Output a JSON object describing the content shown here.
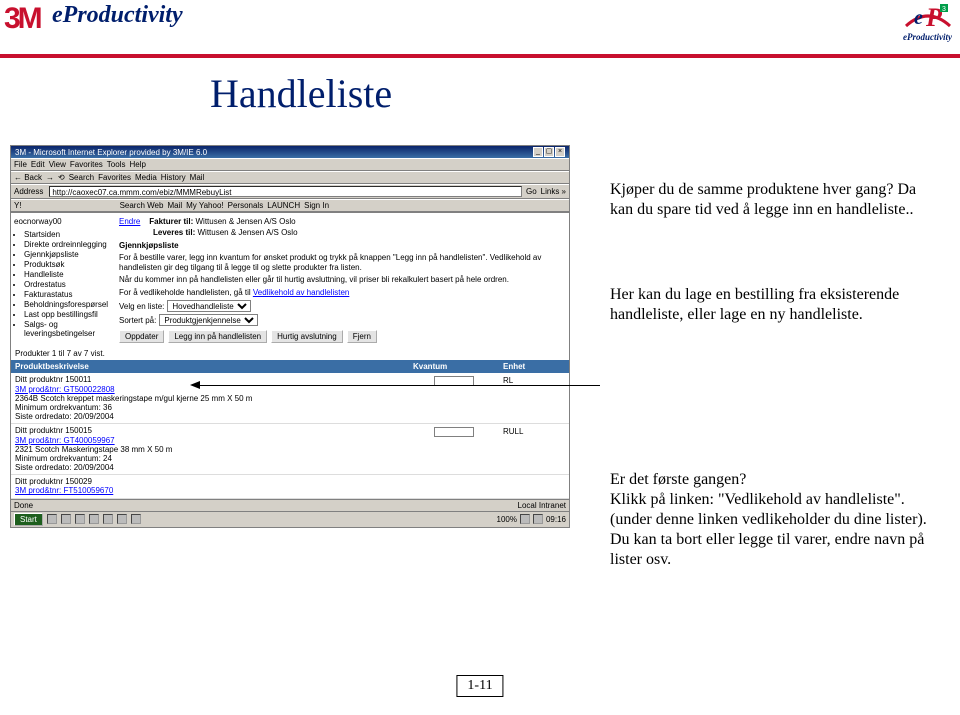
{
  "header": {
    "logo3m": "3M",
    "logoText": "eProductivity",
    "epSub": "eProductivity"
  },
  "slide": {
    "title": "Handleliste",
    "pageNumber": "1-11"
  },
  "browser": {
    "title": "3M - Microsoft Internet Explorer provided by 3M/IE 6.0",
    "menubar": [
      "File",
      "Edit",
      "View",
      "Favorites",
      "Tools",
      "Help"
    ],
    "toolbar": [
      "← Back",
      "→",
      "⟲",
      "Search",
      "Favorites",
      "Media",
      "History",
      "Mail"
    ],
    "addrLabel": "Address",
    "url": "http://caoxec07.ca.mmm.com/ebiz/MMMRebuyList",
    "goLabel": "Go",
    "linksLabel": "Links »",
    "ybar": [
      "Y!",
      "Search Web",
      "Mail",
      "My Yahoo!",
      "Personals",
      "LAUNCH",
      "Sign In"
    ],
    "account": "eocnorway00",
    "sideItems": [
      "Startsiden",
      "Direkte ordreinnlegging",
      "Gjennkjøpsliste",
      "Produktsøk",
      "Handleliste",
      "Ordrestatus",
      "Fakturastatus",
      "Beholdningsforespørsel",
      "Last opp bestillingsfil",
      "Salgs- og leveringsbetingelser"
    ],
    "endreLabel": "Endre",
    "faktLabel": "Fakturer til:",
    "faktVal": "Wittusen & Jensen A/S Oslo",
    "levLabel": "Leveres til:",
    "levVal": "Wittusen & Jensen A/S Oslo",
    "listTitle": "Gjennkjøpsliste",
    "para1": "For å bestille varer, legg inn kvantum for ønsket produkt og trykk på knappen \"Legg inn på handlelisten\". Vedlikehold av handlelisten gir deg tilgang til å legge til og slette produkter fra listen.",
    "para2": "Når du kommer inn på handlelisten eller går til hurtig avsluttning, vil priser bli rekalkulert basert på hele ordren.",
    "para3a": "For å vedlikeholde handlelisten, gå til ",
    "para3link": "Vedlikehold av handlelisten",
    "velgLabel": "Velg en liste:",
    "velgVal": "Hovedhandleliste",
    "sortLabel": "Sortert på:",
    "sortVal": "Produktgjenkjennelse",
    "buttons": [
      "Oppdater",
      "Legg inn på handlelisten",
      "Hurtig avslutning",
      "Fjern"
    ],
    "prodCount": "Produkter 1 til 7 av 7 vist.",
    "th1": "Produktbeskrivelse",
    "th2": "Kvantum",
    "th3": "Enhet",
    "prods": [
      {
        "pn": "Ditt produktnr 150011",
        "link": "3M prod&tnr: GT500022808",
        "desc": "2364B Scotch kreppet maskeringstape m/gul kjerne 25 mm X 50 m",
        "min": "Minimum ordrekvantum: 36",
        "date": "Siste ordredato: 20/09/2004",
        "unit": "RL"
      },
      {
        "pn": "Ditt produktnr 150015",
        "link": "3M prod&tnr: GT400059967",
        "desc": "2321 Scotch Maskeringstape 38 mm X 50 m",
        "min": "Minimum ordrekvantum: 24",
        "date": "Siste ordredato: 20/09/2004",
        "unit": "RULL"
      },
      {
        "pn": "Ditt produktnr 150029",
        "link": "3M prod&tnr: FT510059670",
        "desc": "",
        "min": "",
        "date": "",
        "unit": ""
      }
    ],
    "statusDone": "Done",
    "statusZone": "Local Intranet",
    "startLabel": "Start",
    "zoom": "100%",
    "clock": "09:16"
  },
  "annotations": {
    "p1": "Kjøper du de samme produktene hver gang? Da kan du spare tid ved å legge inn en handleliste..",
    "p2": "Her kan du lage en bestilling fra eksisterende handleliste, eller lage en ny handleliste.",
    "p3": "Er det første gangen?\nKlikk på linken: \"Vedlikehold av handleliste\". (under denne linken vedlikeholder du dine lister). Du kan ta bort eller legge til varer, endre navn på lister osv."
  }
}
